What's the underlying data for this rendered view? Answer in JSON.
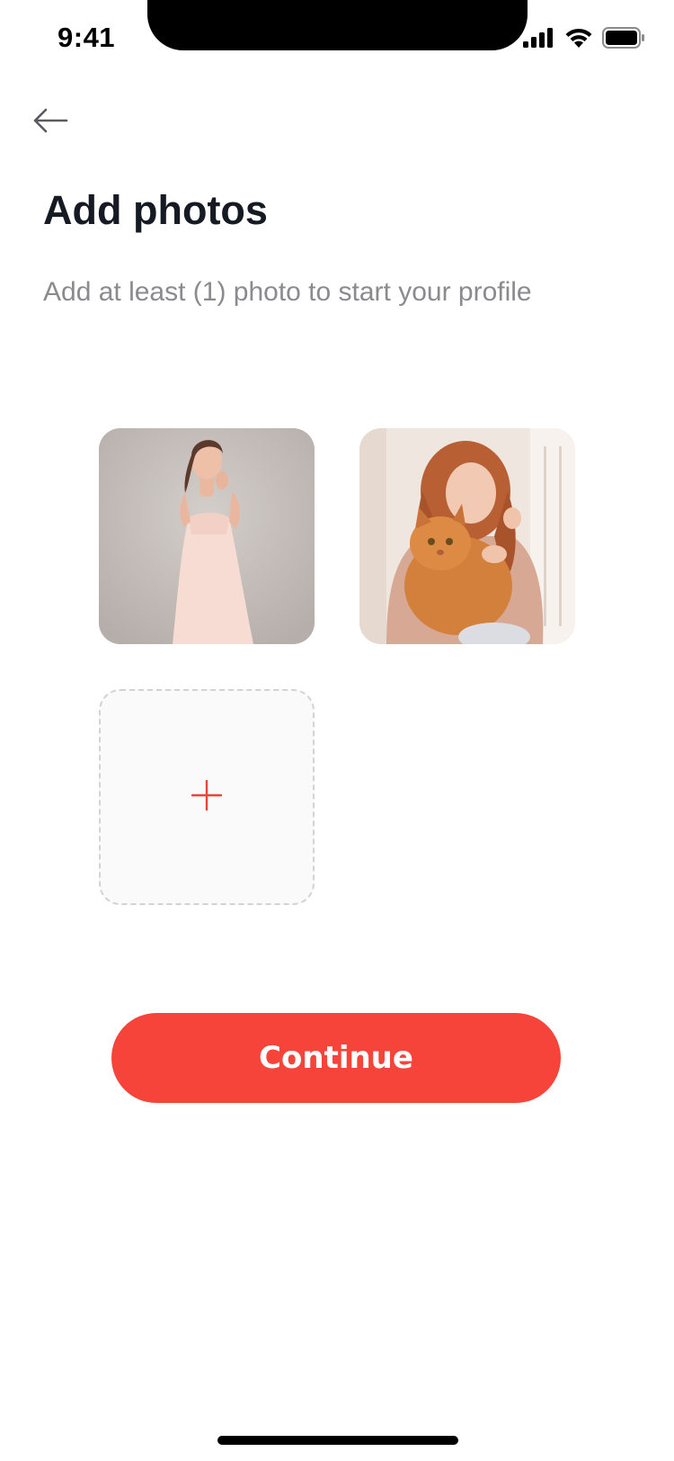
{
  "status_bar": {
    "time": "9:41",
    "icons": [
      "signal-icon",
      "wifi-icon",
      "battery-icon"
    ]
  },
  "header": {
    "back_icon": "arrow-left-icon"
  },
  "page": {
    "title": "Add photos",
    "subtitle": "Add at least (1) photo to start your profile"
  },
  "photos": [
    {
      "description": "woman-in-pink-dress"
    },
    {
      "description": "woman-holding-cat"
    }
  ],
  "add_tile": {
    "icon": "plus-icon"
  },
  "actions": {
    "continue_label": "Continue"
  },
  "colors": {
    "accent": "#F6443A",
    "title": "#161A23",
    "subtitle": "#8A8A8F",
    "tile_border": "#D3D3D6",
    "tile_background": "#FAFAFA"
  }
}
